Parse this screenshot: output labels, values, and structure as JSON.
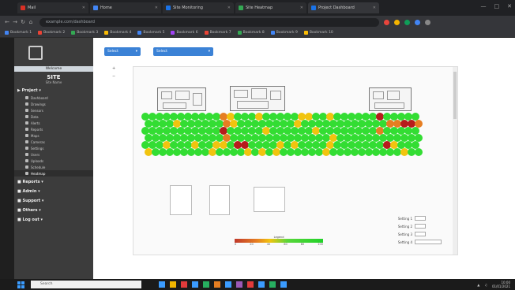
{
  "browser": {
    "tabs": [
      {
        "label": "Mail",
        "color": "#d93025",
        "active": false
      },
      {
        "label": "Home",
        "color": "#4285f4",
        "active": false
      },
      {
        "label": "Site Monitoring",
        "color": "#1a73e8",
        "active": false
      },
      {
        "label": "Site Heatmap",
        "color": "#34a853",
        "active": false
      },
      {
        "label": "Project Dashboard",
        "color": "#1a73e8",
        "active": true
      }
    ],
    "url": "example.com/dashboard",
    "bookmarks": [
      {
        "label": "Bookmark 1",
        "color": "#4285f4"
      },
      {
        "label": "Bookmark 2",
        "color": "#ea4335"
      },
      {
        "label": "Bookmark 3",
        "color": "#34a853"
      },
      {
        "label": "Bookmark 4",
        "color": "#fbbc05"
      },
      {
        "label": "Bookmark 5",
        "color": "#4285f4"
      },
      {
        "label": "Bookmark 6",
        "color": "#a142f4"
      },
      {
        "label": "Bookmark 7",
        "color": "#ea4335"
      },
      {
        "label": "Bookmark 8",
        "color": "#34a853"
      },
      {
        "label": "Bookmark 9",
        "color": "#4285f4"
      },
      {
        "label": "Bookmark 10",
        "color": "#fbbc05"
      }
    ]
  },
  "sidebar": {
    "welcome": "Welcome",
    "site_code": "SITE",
    "site_name": "Site Name",
    "project_heading": "Project",
    "project_items": [
      {
        "label": "Dashboard",
        "selected": false
      },
      {
        "label": "Drawings",
        "selected": false
      },
      {
        "label": "Sensors",
        "selected": false
      },
      {
        "label": "Data",
        "selected": false
      },
      {
        "label": "Alerts",
        "selected": false
      },
      {
        "label": "Reports",
        "selected": false
      },
      {
        "label": "Maps",
        "selected": false
      },
      {
        "label": "Cameras",
        "selected": false
      },
      {
        "label": "Settings",
        "selected": false
      },
      {
        "label": "Users",
        "selected": false
      },
      {
        "label": "Uploads",
        "selected": false
      },
      {
        "label": "Schedule",
        "selected": false
      },
      {
        "label": "Heatmap",
        "selected": true
      }
    ],
    "sections": [
      "Reports",
      "Admin",
      "Support",
      "Others",
      "Log out"
    ]
  },
  "main": {
    "dropdown_1": "Select",
    "dropdown_2": "Select",
    "legend_title": "Legend",
    "legend_ticks": [
      "0",
      "20",
      "40",
      "60",
      "80",
      "100"
    ],
    "controls": [
      {
        "label": "Setting 1",
        "kind": "field"
      },
      {
        "label": "Setting 2",
        "kind": "field"
      },
      {
        "label": "Setting 3",
        "kind": "field"
      },
      {
        "label": "Setting 4",
        "kind": "select"
      }
    ]
  },
  "taskbar": {
    "search_placeholder": "Search",
    "icon_colors": [
      "#3b9cff",
      "#f2b600",
      "#e23b3b",
      "#3b9cff",
      "#27ae60",
      "#e67e22",
      "#3b9cff",
      "#9b59b6",
      "#e23b3b",
      "#3b9cff",
      "#27ae60",
      "#3b9cff"
    ],
    "time": "10:00",
    "date": "01/01/2021"
  },
  "colors": {
    "accent": "#3b82d6",
    "heat_red": "#b71c1c",
    "heat_orange": "#e67e22",
    "heat_yellow": "#f1c40f",
    "heat_green": "#33dd33"
  }
}
